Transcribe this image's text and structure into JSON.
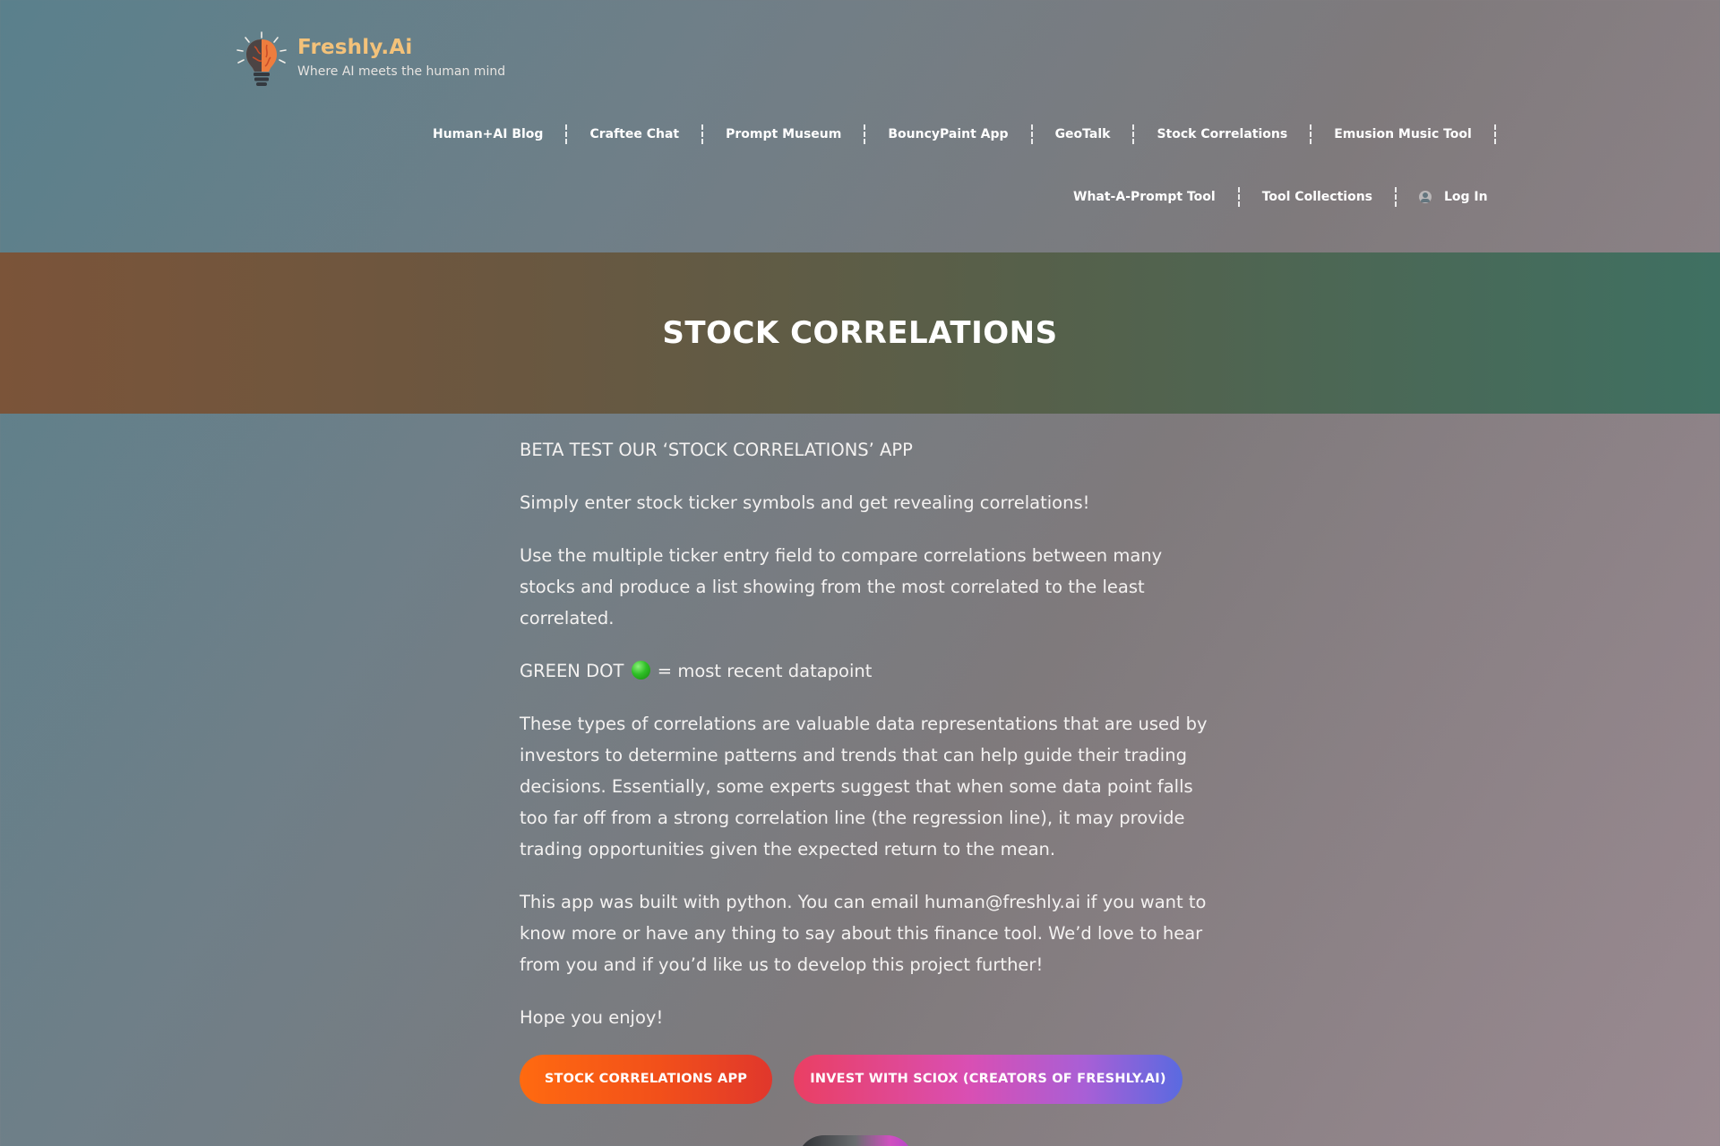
{
  "brand": {
    "name": "Freshly.Ai",
    "tagline": "Where AI meets the human mind"
  },
  "nav": {
    "row1": [
      "Human+AI Blog",
      "Craftee Chat",
      "Prompt Museum",
      "BouncyPaint App",
      "GeoTalk",
      "Stock Correlations",
      "Emusion Music Tool"
    ],
    "row2": [
      "What-A-Prompt Tool",
      "Tool Collections"
    ],
    "login_label": "Log In"
  },
  "hero": {
    "title": "STOCK CORRELATIONS"
  },
  "content": {
    "heading": "BETA TEST OUR ‘STOCK CORRELATIONS’ APP",
    "intro": "Simply enter stock ticker symbols and get revealing correlations!",
    "multi_ticker": "Use the multiple ticker entry field to compare correlations between many stocks and produce a list showing from the most correlated to the least correlated.",
    "green_dot_prefix": "GREEN DOT",
    "green_dot_suffix": "= most recent datapoint",
    "explanation": "These types of correlations are valuable data representations that are used by investors to determine patterns and trends that can help guide their trading decisions. Essentially, some experts suggest that when some data point falls too far off from a strong correlation line (the regression line), it may provide trading opportunities given the expected return to the mean.",
    "built_with": "This app was built with python. You can email human@freshly.ai if you want to know more or have any thing to say about this finance tool. We’d love to hear from you and if you’d like us to develop this project further!",
    "closing": "Hope you enjoy!"
  },
  "buttons": {
    "app_label": "STOCK CORRELATIONS APP",
    "invest_label": "INVEST WITH SCIOX (CREATORS OF FRESHLY.AI)"
  },
  "icons": {
    "logo": "lightbulb-brain-icon",
    "login": "user-circle-icon",
    "green_dot": "green-circle-icon"
  },
  "colors": {
    "brand_name": "#f3c27a",
    "button_app_start": "#ff6a10",
    "button_app_end": "#e0372c",
    "button_invest_start": "#ea3f63",
    "button_invest_end": "#5a6ae0",
    "green_dot": "#2fbf26"
  }
}
